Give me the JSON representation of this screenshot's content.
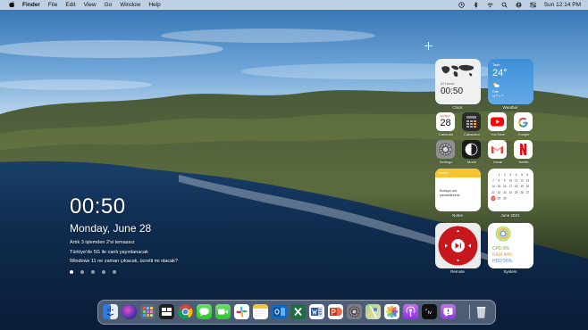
{
  "menubar": {
    "apple": "",
    "app_name": "Finder",
    "menus": [
      "File",
      "Edit",
      "View",
      "Go",
      "Window",
      "Help"
    ],
    "clock": "Sun 12:14 PM"
  },
  "widgets": {
    "clock": {
      "location": "At Home",
      "time": "00:50",
      "label": "Clock"
    },
    "weather": {
      "city": "Tash",
      "temp": "24°",
      "condition": "Fair",
      "range": "H:*° L:*°",
      "label": "Weather"
    },
    "notes": {
      "header": "Notes",
      "body": "Buraya not yazabilirsiniz",
      "label": "Notes"
    },
    "calendar": {
      "label": "June 2021"
    },
    "remote": {
      "label": "Remote"
    },
    "system": {
      "cpu": "CPU 8%",
      "ram": "RAM 44%",
      "hdd": "HDD 55%",
      "label": "System"
    }
  },
  "apps": [
    {
      "label": "Calendar",
      "day": "28",
      "month": "MONDAY"
    },
    {
      "label": "Calculator"
    },
    {
      "label": "YouTube"
    },
    {
      "label": "Google"
    },
    {
      "label": "Settings"
    },
    {
      "label": "Mode"
    },
    {
      "label": "Gmail"
    },
    {
      "label": "Netflix"
    }
  ],
  "overlay": {
    "time": "00:50",
    "date": "Monday, June 28",
    "news": [
      "Artık 3 işlemden 2'si temassız",
      "Türkiye'de 5G ile canlı yayınlanacak",
      "Windows 11 ne zaman çıkacak, ücretli mi olacak?"
    ]
  },
  "dock_apps": [
    "Finder",
    "Siri",
    "Launchpad",
    "Mission Control",
    "Chrome",
    "Messages",
    "FaceTime",
    "Slack",
    "Notes",
    "Outlook",
    "Excel",
    "Word",
    "PowerPoint",
    "Settings",
    "Maps",
    "Photos",
    "Podcasts",
    "Apple TV",
    "Feedback",
    "Trash"
  ]
}
